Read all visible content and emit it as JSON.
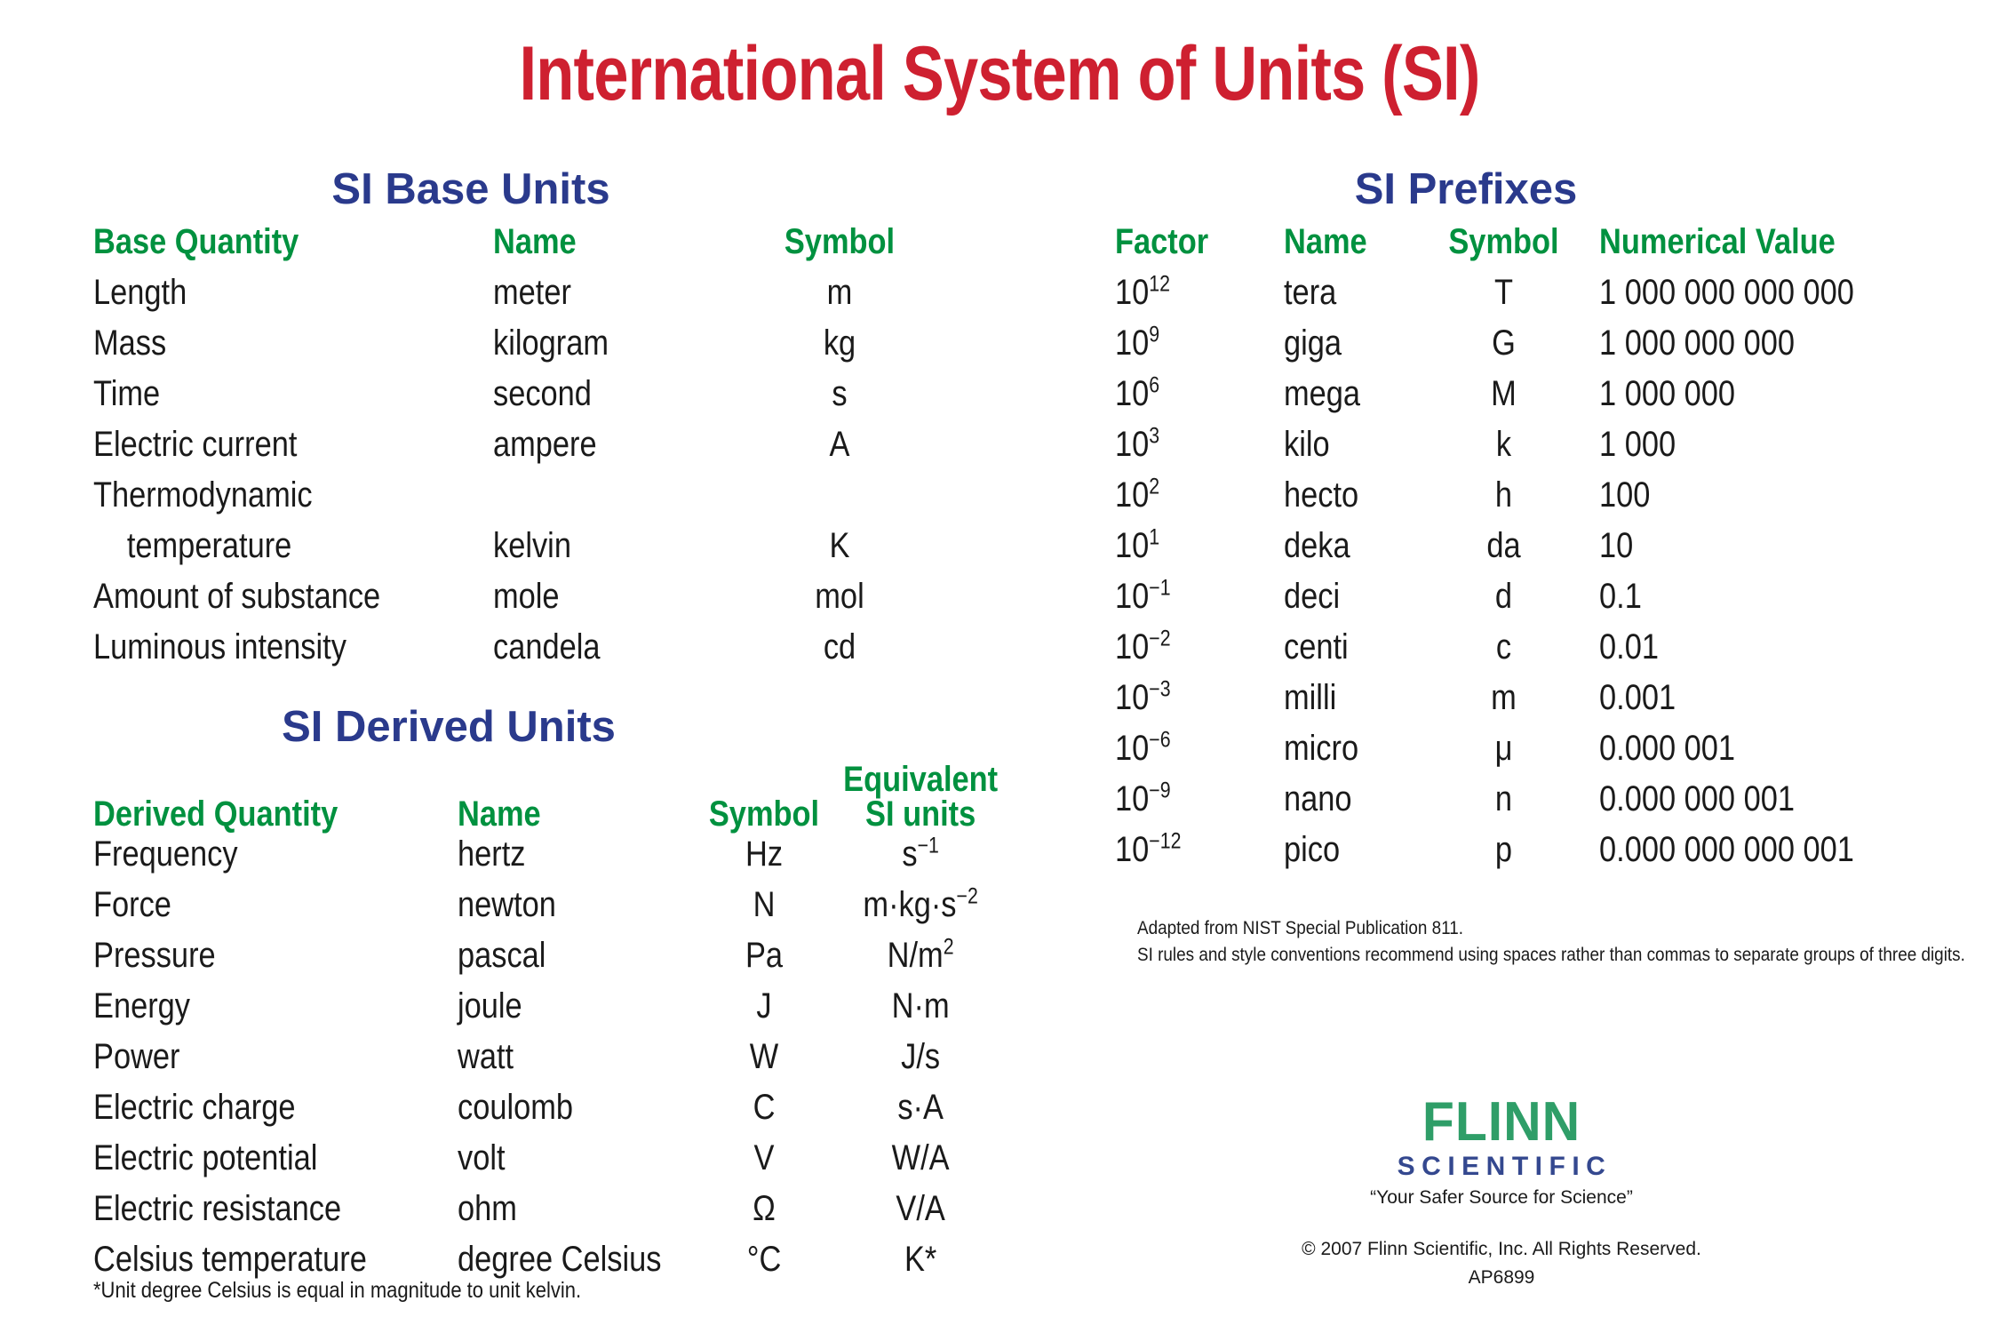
{
  "title": "International System of Units (SI)",
  "base_units": {
    "heading": "SI Base Units",
    "columns": [
      "Base Quantity",
      "Name",
      "Symbol"
    ],
    "rows": [
      {
        "quantity": "Length",
        "quantity_line2": "",
        "name": "meter",
        "symbol": "m"
      },
      {
        "quantity": "Mass",
        "quantity_line2": "",
        "name": "kilogram",
        "symbol": "kg"
      },
      {
        "quantity": "Time",
        "quantity_line2": "",
        "name": "second",
        "symbol": "s"
      },
      {
        "quantity": "Electric current",
        "quantity_line2": "",
        "name": "ampere",
        "symbol": "A"
      },
      {
        "quantity": "Thermodynamic",
        "quantity_line2": "temperature",
        "name": "kelvin",
        "symbol": "K"
      },
      {
        "quantity": "Amount of substance",
        "quantity_line2": "",
        "name": "mole",
        "symbol": "mol"
      },
      {
        "quantity": "Luminous intensity",
        "quantity_line2": "",
        "name": "candela",
        "symbol": "cd"
      }
    ]
  },
  "derived_units": {
    "heading": "SI Derived Units",
    "columns": [
      "Derived Quantity",
      "Name",
      "Symbol",
      "Equivalent",
      "SI units"
    ],
    "rows": [
      {
        "quantity": "Frequency",
        "name": "hertz",
        "symbol": "Hz",
        "equivalent": "s−1",
        "equivalent_base": "s",
        "equivalent_sup": "−1"
      },
      {
        "quantity": "Force",
        "name": "newton",
        "symbol": "N",
        "equivalent": "m·kg·s−2",
        "equivalent_base": "m·kg·s",
        "equivalent_sup": "−2"
      },
      {
        "quantity": "Pressure",
        "name": "pascal",
        "symbol": "Pa",
        "equivalent": "N/m2",
        "equivalent_base": "N/m",
        "equivalent_sup": "2"
      },
      {
        "quantity": "Energy",
        "name": "joule",
        "symbol": "J",
        "equivalent": "N·m",
        "equivalent_base": "N·m",
        "equivalent_sup": ""
      },
      {
        "quantity": "Power",
        "name": "watt",
        "symbol": "W",
        "equivalent": "J/s",
        "equivalent_base": "J/s",
        "equivalent_sup": ""
      },
      {
        "quantity": "Electric charge",
        "name": "coulomb",
        "symbol": "C",
        "equivalent": "s·A",
        "equivalent_base": "s·A",
        "equivalent_sup": ""
      },
      {
        "quantity": "Electric potential",
        "name": "volt",
        "symbol": "V",
        "equivalent": "W/A",
        "equivalent_base": "W/A",
        "equivalent_sup": ""
      },
      {
        "quantity": "Electric resistance",
        "name": "ohm",
        "symbol": "Ω",
        "equivalent": "V/A",
        "equivalent_base": "V/A",
        "equivalent_sup": ""
      },
      {
        "quantity": "Celsius temperature",
        "name": "degree Celsius",
        "symbol": "°C",
        "equivalent": "K*",
        "equivalent_base": "K*",
        "equivalent_sup": ""
      }
    ],
    "footnote": "*Unit degree Celsius is equal in magnitude to unit kelvin."
  },
  "prefixes": {
    "heading": "SI Prefixes",
    "columns": [
      "Factor",
      "Name",
      "Symbol",
      "Numerical Value"
    ],
    "rows": [
      {
        "factor_base": "10",
        "factor_exp": "12",
        "name": "tera",
        "symbol": "T",
        "value": "1 000 000 000 000"
      },
      {
        "factor_base": "10",
        "factor_exp": "9",
        "name": "giga",
        "symbol": "G",
        "value": "1 000 000 000"
      },
      {
        "factor_base": "10",
        "factor_exp": "6",
        "name": "mega",
        "symbol": "M",
        "value": "1 000 000"
      },
      {
        "factor_base": "10",
        "factor_exp": "3",
        "name": "kilo",
        "symbol": "k",
        "value": "1 000"
      },
      {
        "factor_base": "10",
        "factor_exp": "2",
        "name": "hecto",
        "symbol": "h",
        "value": "100"
      },
      {
        "factor_base": "10",
        "factor_exp": "1",
        "name": "deka",
        "symbol": "da",
        "value": "10"
      },
      {
        "factor_base": "10",
        "factor_exp": "−1",
        "name": "deci",
        "symbol": "d",
        "value": "0.1"
      },
      {
        "factor_base": "10",
        "factor_exp": "−2",
        "name": "centi",
        "symbol": "c",
        "value": "0.01"
      },
      {
        "factor_base": "10",
        "factor_exp": "−3",
        "name": "milli",
        "symbol": "m",
        "value": "0.001"
      },
      {
        "factor_base": "10",
        "factor_exp": "−6",
        "name": "micro",
        "symbol": "μ",
        "value": "0.000 001"
      },
      {
        "factor_base": "10",
        "factor_exp": "−9",
        "name": "nano",
        "symbol": "n",
        "value": "0.000 000 001"
      },
      {
        "factor_base": "10",
        "factor_exp": "−12",
        "name": "pico",
        "symbol": "p",
        "value": "0.000 000 000 001"
      }
    ],
    "source_note_line1": "Adapted from NIST Special Publication 811.",
    "source_note_line2": "SI rules and style conventions recommend using spaces rather than commas to separate groups of three digits."
  },
  "logo": {
    "brand": "FLINN",
    "subbrand": "SCIENTIFIC",
    "tagline": "“Your Safer Source for Science”"
  },
  "footer": {
    "copyright": "© 2007 Flinn Scientific, Inc. All Rights Reserved.",
    "product_code": "AP6899"
  },
  "colors": {
    "title_red": "#ce2030",
    "heading_navy": "#2a3a8c",
    "column_green": "#00913f",
    "logo_green": "#2f9e68",
    "logo_navy": "#34488f",
    "text_black": "#1a1a1a",
    "background": "#ffffff"
  }
}
